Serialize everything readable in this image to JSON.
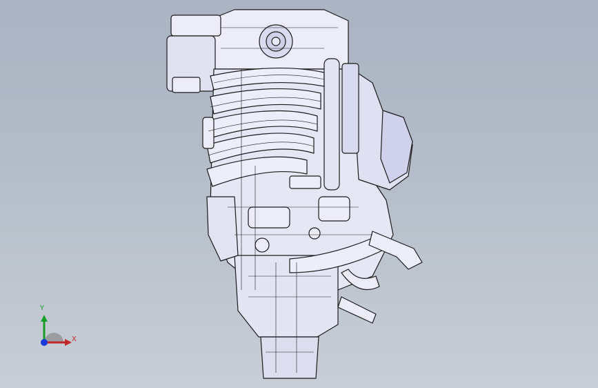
{
  "viewport": {
    "background_top": "#a9b3c2",
    "background_bottom": "#c8ced6",
    "model": "engine-assembly",
    "shading": "shaded-with-edges",
    "part_fill": "#ecedf8",
    "part_edge": "#1a1a1a"
  },
  "triad": {
    "x_label": "X",
    "y_label": "Y",
    "x_color": "#c0262c",
    "y_color": "#1a9e2a",
    "z_color": "#1b39d6"
  }
}
